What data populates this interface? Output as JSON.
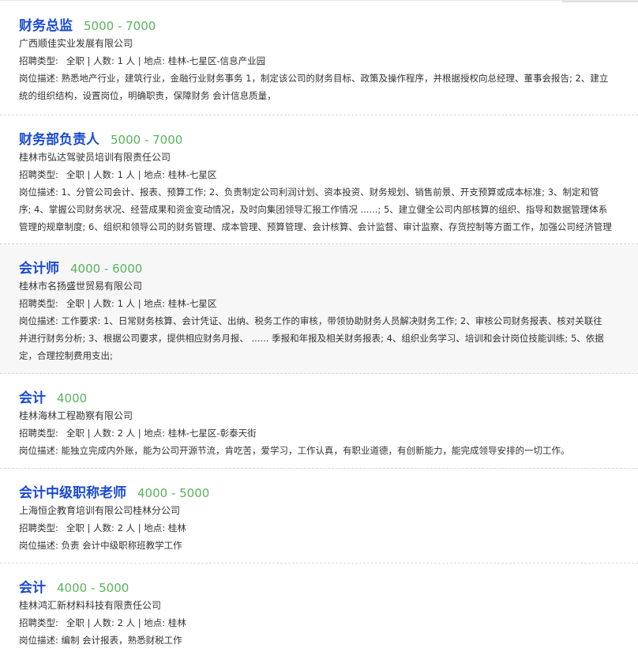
{
  "jobs": [
    {
      "title": "财务总监",
      "salary": "5000 - 7000",
      "company": "广西顺佳实业发展有限公司",
      "meta_label": "招聘类型:",
      "meta": "全职 | 人数: 1 人 | 地点: 桂林-七星区-信息产业园",
      "desc_lines": [
        "岗位描述:  熟悉地产行业，建筑行业，金融行业财务事务 1，制定该公司的财务目标、政策及操作程序，并根据授权向总经理、董事会报告;  2、建立",
        "统的组织结构，设置岗位，明确职责，保障财务 会计信息质量，"
      ]
    },
    {
      "title": "财务部负责人",
      "salary": "5000 - 7000",
      "company": "桂林市弘达驾驶员培训有限责任公司",
      "meta_label": "招聘类型:",
      "meta": "全职 | 人数: 1 人 | 地点: 桂林-七星区",
      "desc_lines": [
        "岗位描述:  1、分管公司会计、报表、预算工作;  2、负责制定公司利润计划、资本投资、财务规划、销售前景、开支预算或成本标准;  3、制定和管",
        "序;  4、掌握公司财务状况、经营成果和资金变动情况，及时向集团领导汇报工作情况 ......;  5、建立健全公司内部核算的组织、指导和数据管理体系",
        "管理的规章制度;  6、组织和领导公司的财务管理、成本管理、预算管理、会计核算、会计监督、审计监察、存货控制等方面工作，加强公司经济管理"
      ]
    },
    {
      "title": "会计师",
      "salary": "4000 - 6000",
      "company": "桂林市名扬盛世贸易有限公司",
      "meta_label": "招聘类型:",
      "meta": "全职 | 人数: 1 人 | 地点: 桂林-七星区",
      "desc_lines": [
        "岗位描述:  工作要求:  1、日常财务核算、会计凭证、出纳、税务工作的审核，带领协助财务人员解决财务工作;  2、审核公司财务报表、核对关联往",
        "并进行财务分析;  3、根据公司要求，提供相应财务月报、 ...... 季报和年报及相关财务报表;  4、组织业务学习、培训和会计岗位技能训练;  5、依据",
        "定，合理控制费用支出;"
      ]
    },
    {
      "title": "会计",
      "salary": "4000",
      "company": "桂林海林工程勘察有限公司",
      "meta_label": "招聘类型:",
      "meta": "全职 | 人数: 2 人 | 地点: 桂林-七星区-彰泰天街",
      "desc_lines": [
        "岗位描述:  能独立完成内外账，能为公司开源节流，肯吃苦，爱学习，工作认真，有职业道德，有创新能力，能完成领导安排的一切工作。"
      ]
    },
    {
      "title": "会计中级职称老师",
      "salary": "4000 - 5000",
      "company": "上海恒企教育培训有限公司桂林分公司",
      "meta_label": "招聘类型:",
      "meta": "全职 | 人数: 2 人 | 地点: 桂林",
      "desc_lines": [
        "岗位描述:  负责 会计中级职称班教学工作"
      ]
    },
    {
      "title": "会计",
      "salary": "4000 - 5000",
      "company": "桂林鸿汇新材料科技有限责任公司",
      "meta_label": "招聘类型:",
      "meta": "全职 | 人数: 2 人 | 地点: 桂林",
      "desc_lines": [
        "岗位描述:  编制 会计报表，熟悉财税工作"
      ]
    }
  ]
}
